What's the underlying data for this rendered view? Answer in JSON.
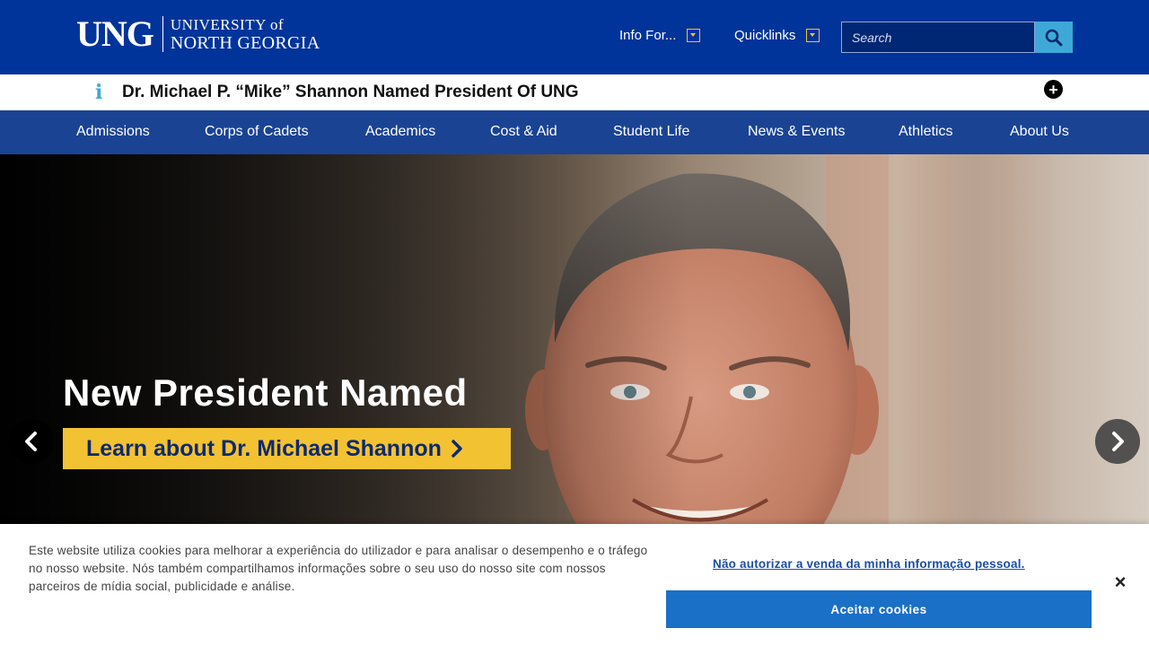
{
  "header": {
    "logo_mark": "UNG",
    "logo_line1": "UNIVERSITY of",
    "logo_line2": "NORTH GEORGIA",
    "info_for_label": "Info For...",
    "quicklinks_label": "Quicklinks",
    "search_placeholder": "Search",
    "brand_color": "#00349a",
    "accent_color": "#f3c233",
    "search_button_icon": "search-icon"
  },
  "alert": {
    "text": "Dr. Michael P. “Mike” Shannon Named President Of UNG",
    "info_icon": "i",
    "expand_icon": "+"
  },
  "nav": {
    "items": [
      {
        "label": "Admissions"
      },
      {
        "label": "Corps of Cadets"
      },
      {
        "label": "Academics"
      },
      {
        "label": "Cost & Aid"
      },
      {
        "label": "Student Life"
      },
      {
        "label": "News & Events"
      },
      {
        "label": "Athletics"
      },
      {
        "label": "About Us"
      }
    ]
  },
  "hero": {
    "title": "New President Named",
    "cta_label": "Learn about Dr. Michael Shannon",
    "prev_icon": "chevron-left-icon",
    "next_icon": "chevron-right-icon"
  },
  "cookie": {
    "text": "Este website utiliza cookies para melhorar a experiência do utilizador e para analisar o desempenho e o tráfego no nosso website. Nós também compartilhamos informações sobre o seu uso do nosso site com nossos parceiros de mídia social, publicidade e análise.",
    "do_not_sell_label": "Não autorizar a venda da minha informação pessoal.",
    "accept_label": "Aceitar cookies",
    "close_icon": "×"
  }
}
